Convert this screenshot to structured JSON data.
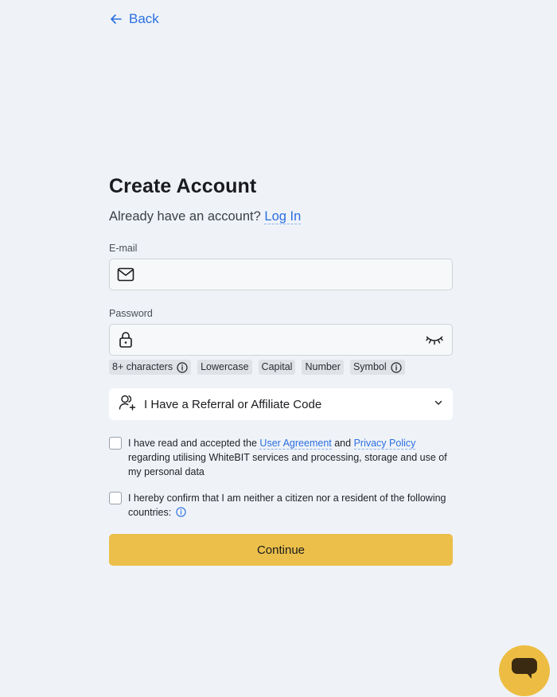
{
  "nav": {
    "back_label": "Back",
    "back_icon": "arrow-left-icon"
  },
  "form": {
    "title": "Create Account",
    "subtitle_prefix": "Already have an account?",
    "login_link": "Log In",
    "email": {
      "label": "E-mail",
      "value": "",
      "placeholder": "",
      "icon": "mail-icon"
    },
    "password": {
      "label": "Password",
      "value": "",
      "placeholder": "",
      "icon": "lock-icon",
      "toggle_icon": "eye-closed-icon"
    },
    "requirements": [
      "8+ characters",
      "Lowercase",
      "Capital",
      "Number",
      "Symbol"
    ],
    "referral": {
      "label": "I Have a Referral or Affiliate Code",
      "icon": "add-user-icon",
      "chevron": "chevron-down-icon"
    },
    "agreement": {
      "checked": false,
      "text_1": "I have read and accepted the",
      "link_1": "User Agreement",
      "text_2": "and",
      "link_2": "Privacy Policy",
      "text_3": "regarding utilising WhiteBIT services and processing, storage and use of my personal data"
    },
    "residency": {
      "checked": false,
      "text": "I hereby confirm that I am neither a citizen nor a resident of the following countries:"
    },
    "continue_label": "Continue"
  },
  "chat": {
    "icon": "chat-bubble-icon"
  },
  "colors": {
    "accent": "#ebbf4a",
    "link": "#2a6ee0",
    "background": "#eff3f8"
  }
}
